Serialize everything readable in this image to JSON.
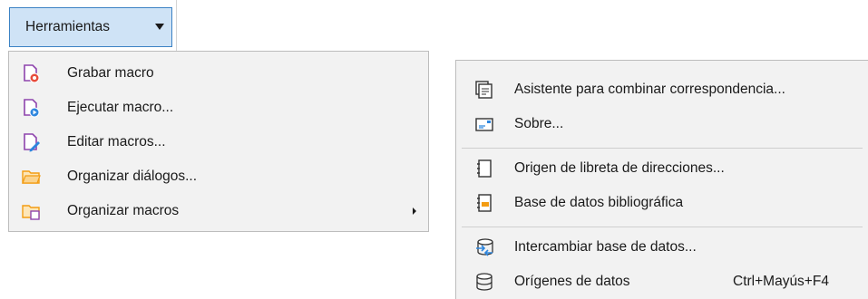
{
  "toolbar": {
    "button_label": "Herramientas"
  },
  "left_menu": {
    "items": [
      {
        "label": "Grabar macro",
        "icon": "record-macro-icon"
      },
      {
        "label": "Ejecutar macro...",
        "icon": "run-macro-icon"
      },
      {
        "label": "Editar macros...",
        "icon": "edit-macros-icon"
      },
      {
        "label": "Organizar diálogos...",
        "icon": "folder-icon"
      },
      {
        "label": "Organizar macros",
        "icon": "organize-macros-icon",
        "has_submenu": true
      }
    ]
  },
  "right_menu": {
    "items": [
      {
        "label": "Asistente para combinar correspondencia...",
        "icon": "mail-merge-icon"
      },
      {
        "label": "Sobre...",
        "icon": "envelope-icon"
      },
      {
        "label": "Origen de libreta de direcciones...",
        "icon": "address-book-icon"
      },
      {
        "label": "Base de datos bibliográfica",
        "icon": "bibliography-icon"
      },
      {
        "label": "Intercambiar base de datos...",
        "icon": "exchange-database-icon"
      },
      {
        "label": "Orígenes de datos",
        "icon": "database-icon",
        "shortcut": "Ctrl+Mayús+F4"
      }
    ]
  },
  "colors": {
    "button_bg": "#cfe3f6",
    "button_border": "#3b82c4",
    "menu_bg": "#f2f2f2",
    "macro_icon": "#8e44ad",
    "folder_icon": "#f39c12"
  }
}
